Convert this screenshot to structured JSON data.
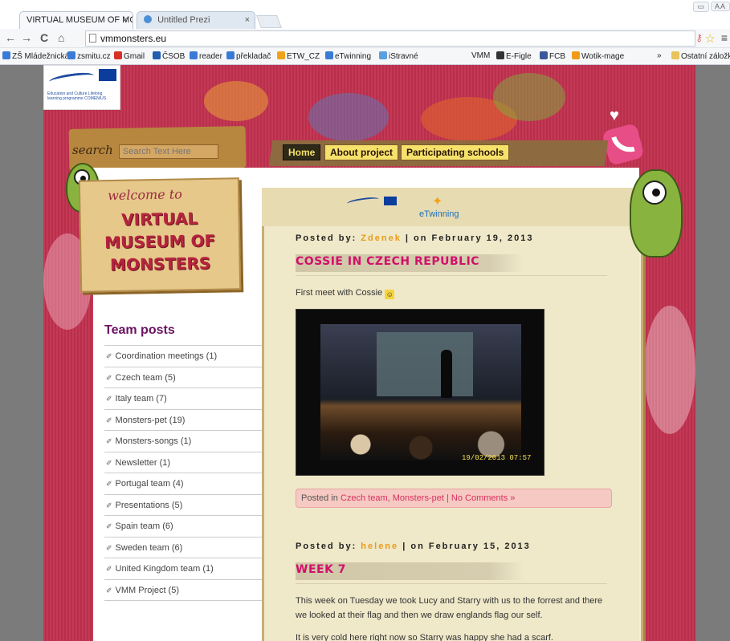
{
  "browser": {
    "tabs": [
      {
        "title": "VIRTUAL MUSEUM OF MC",
        "close": "×"
      },
      {
        "title": "Untitled Prezi",
        "close": "×"
      }
    ],
    "window_controls": [
      "▭",
      "AA"
    ],
    "url": "vmmonsters.eu",
    "nav": {
      "back": "←",
      "forward": "→",
      "reload": "C",
      "home": "⌂"
    },
    "star": "☆",
    "menu": "≡",
    "bookmarks": [
      {
        "label": "ZŠ Mládežnická",
        "color": "#3a7bd5"
      },
      {
        "label": "zsmitu.cz",
        "color": "#3a7bd5"
      },
      {
        "label": "Gmail",
        "color": "#d93025"
      },
      {
        "label": "ČSOB",
        "color": "#1f5fae"
      },
      {
        "label": "reader",
        "color": "#3a7bd5"
      },
      {
        "label": "překladač",
        "color": "#3a7bd5"
      },
      {
        "label": "ETW_CZ",
        "color": "#f2a219"
      },
      {
        "label": "eTwinning",
        "color": "#3a7bd5"
      },
      {
        "label": "iStravné",
        "color": "#5aa0de"
      },
      {
        "label": "VMM",
        "color": ""
      },
      {
        "label": "E-Figle",
        "color": "#333"
      },
      {
        "label": "FCB",
        "color": "#3b5998"
      },
      {
        "label": "Wotik-mage",
        "color": "#f29b1b"
      },
      {
        "label": "»",
        "color": ""
      },
      {
        "label": "Ostatní záložky",
        "color": "#e8c35a"
      }
    ]
  },
  "site": {
    "eu_logo_text": "Education and Culture Lifelong learning programme COMENIUS",
    "search": {
      "label": "search",
      "placeholder": "Search Text Here"
    },
    "menu": [
      {
        "label": "Home"
      },
      {
        "label": "About project"
      },
      {
        "label": "Participating schools"
      }
    ],
    "welcome": {
      "line1": "welcome to",
      "line2": "VIRTUAL MUSEUM OF MONSTERS"
    },
    "sidebar": {
      "title": "Team posts",
      "categories": [
        "Coordination meetings (1)",
        "Czech team (5)",
        "Italy team (7)",
        "Monsters-pet (19)",
        "Monsters-songs (1)",
        "Newsletter (1)",
        "Portugal team (4)",
        "Presentations (5)",
        "Spain team (6)",
        "Sweden team (6)",
        "United Kingdom team (1)",
        "VMM Project (5)"
      ]
    },
    "etwinning": "eTwinning",
    "posts": [
      {
        "posted_by_label": "Posted by:",
        "author": "Zdenek",
        "date": "| on February 19, 2013",
        "title": "COSSIE IN CZECH REPUBLIC",
        "body": "First meet with Cossie",
        "photo_stamp": "19/02/2013 07:57",
        "posted_in_label": "Posted in",
        "posted_in_links": "Czech team, Monsters-pet | No Comments »"
      },
      {
        "posted_by_label": "Posted by:",
        "author": "helene",
        "date": "| on February 15, 2013",
        "title": "WEEK 7",
        "body": "This week on Tuesday we took Lucy and Starry with us to the forrest and there we looked at their flag and then we draw englands flag our self.",
        "body2": "It is very cold here right now so Starry was happy she had a scarf."
      }
    ]
  }
}
